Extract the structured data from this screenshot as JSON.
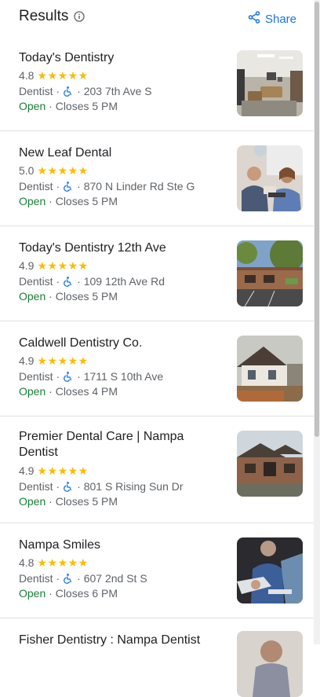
{
  "header": {
    "title": "Results",
    "share_label": "Share"
  },
  "results": [
    {
      "name": "Today's Dentistry",
      "rating": "4.8",
      "stars": "★★★★★",
      "category": "Dentist",
      "address": "203 7th Ave S",
      "open_label": "Open",
      "closes": "Closes 5 PM"
    },
    {
      "name": "New Leaf Dental",
      "rating": "5.0",
      "stars": "★★★★★",
      "category": "Dentist",
      "address": "870 N Linder Rd Ste G",
      "open_label": "Open",
      "closes": "Closes 5 PM"
    },
    {
      "name": "Today's Dentistry 12th Ave",
      "rating": "4.9",
      "stars": "★★★★★",
      "category": "Dentist",
      "address": "109 12th Ave Rd",
      "open_label": "Open",
      "closes": "Closes 5 PM"
    },
    {
      "name": "Caldwell Dentistry Co.",
      "rating": "4.9",
      "stars": "★★★★★",
      "category": "Dentist",
      "address": "1711 S 10th Ave",
      "open_label": "Open",
      "closes": "Closes 4 PM"
    },
    {
      "name": "Premier Dental Care | Nampa Dentist",
      "rating": "4.9",
      "stars": "★★★★★",
      "category": "Dentist",
      "address": "801 S Rising Sun Dr",
      "open_label": "Open",
      "closes": "Closes 5 PM"
    },
    {
      "name": "Nampa Smiles",
      "rating": "4.8",
      "stars": "★★★★★",
      "category": "Dentist",
      "address": "607 2nd St S",
      "open_label": "Open",
      "closes": "Closes 6 PM"
    },
    {
      "name": "Fisher Dentistry : Nampa Dentist"
    }
  ],
  "colors": {
    "accent": "#1a73e8",
    "open_green": "#188038",
    "star_yellow": "#fbbc04"
  },
  "icons": {
    "info": "info-icon",
    "share": "share-icon",
    "accessibility": "wheelchair-accessible-icon"
  }
}
